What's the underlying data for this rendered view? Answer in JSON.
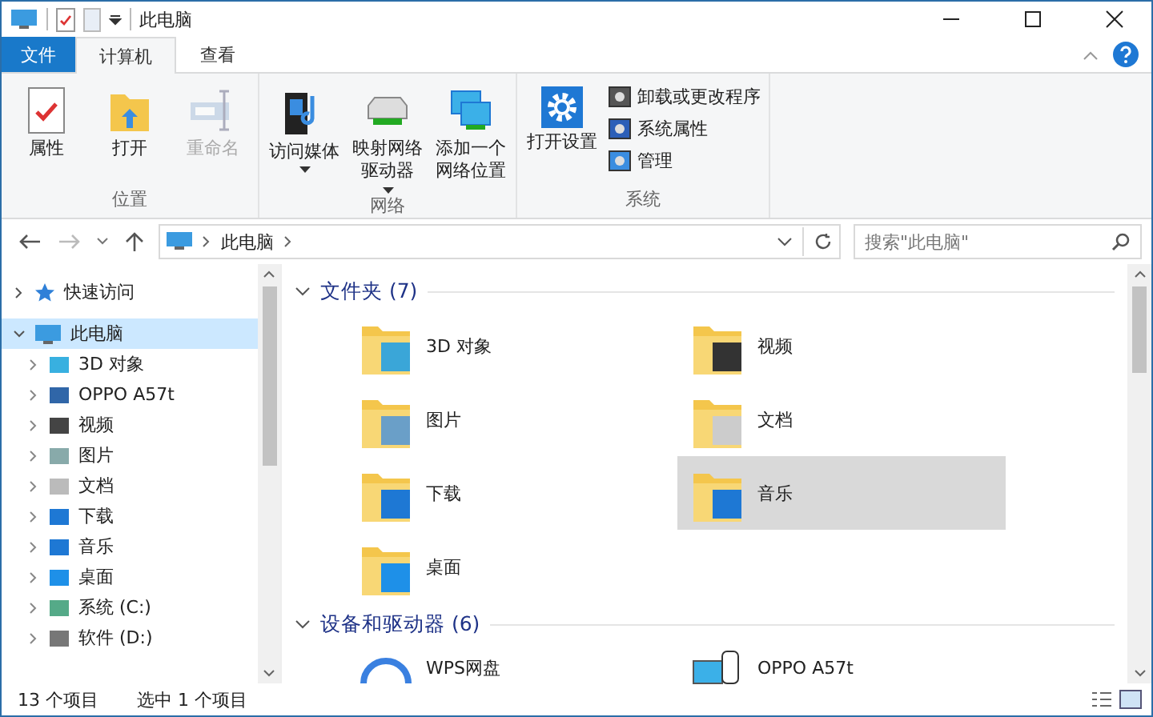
{
  "window": {
    "title": "此电脑"
  },
  "ribbon_tabs": [
    {
      "label": "文件",
      "kind": "file",
      "selected": false
    },
    {
      "label": "计算机",
      "kind": "tab",
      "selected": true
    },
    {
      "label": "查看",
      "kind": "tab",
      "selected": false
    }
  ],
  "ribbon_groups": [
    {
      "label": "位置",
      "commands": [
        {
          "label": "属性",
          "kind": "large",
          "disabled": false
        },
        {
          "label": "打开",
          "kind": "large",
          "disabled": false
        },
        {
          "label": "重命名",
          "kind": "large",
          "disabled": true
        }
      ]
    },
    {
      "label": "网络",
      "commands": [
        {
          "label": "访问媒体",
          "kind": "large",
          "disabled": false,
          "dropdown": true
        },
        {
          "label": "映射网络驱动器",
          "kind": "large",
          "disabled": false,
          "dropdown": true
        },
        {
          "label": "添加一个网络位置",
          "kind": "large",
          "disabled": false
        }
      ]
    },
    {
      "label": "系统",
      "commands": [
        {
          "label": "打开设置",
          "kind": "large",
          "disabled": false
        },
        {
          "label": "卸载或更改程序",
          "kind": "small",
          "disabled": false
        },
        {
          "label": "系统属性",
          "kind": "small",
          "disabled": false
        },
        {
          "label": "管理",
          "kind": "small",
          "disabled": false
        }
      ]
    }
  ],
  "address": {
    "breadcrumb": [
      "此电脑"
    ]
  },
  "search": {
    "placeholder": "搜索\"此电脑\""
  },
  "navigation": [
    {
      "label": "快速访问",
      "expanded": false,
      "selected": false
    },
    {
      "label": "此电脑",
      "expanded": true,
      "selected": true,
      "children": [
        {
          "label": "3D 对象",
          "expanded": false,
          "selected": false
        },
        {
          "label": "OPPO A57t",
          "expanded": false,
          "selected": false
        },
        {
          "label": "视频",
          "expanded": false,
          "selected": false
        },
        {
          "label": "图片",
          "expanded": false,
          "selected": false
        },
        {
          "label": "文档",
          "expanded": false,
          "selected": false
        },
        {
          "label": "下载",
          "expanded": false,
          "selected": false
        },
        {
          "label": "音乐",
          "expanded": false,
          "selected": false
        },
        {
          "label": "桌面",
          "expanded": false,
          "selected": false
        },
        {
          "label": "系统 (C:)",
          "expanded": false,
          "selected": false
        },
        {
          "label": "软件 (D:)",
          "expanded": false,
          "selected": false
        }
      ]
    }
  ],
  "sections": [
    {
      "title": "文件夹 (7)",
      "expanded": true,
      "items": [
        {
          "label": "3D 对象",
          "selected": false
        },
        {
          "label": "视频",
          "selected": false
        },
        {
          "label": "图片",
          "selected": false
        },
        {
          "label": "文档",
          "selected": false
        },
        {
          "label": "下载",
          "selected": false
        },
        {
          "label": "音乐",
          "selected": true
        },
        {
          "label": "桌面",
          "selected": false
        }
      ]
    },
    {
      "title": "设备和驱动器 (6)",
      "expanded": true,
      "items": [
        {
          "label": "WPS网盘",
          "selected": false
        },
        {
          "label": "OPPO A57t",
          "selected": false
        }
      ]
    }
  ],
  "status_bar": {
    "item_count": "13 个项目",
    "selection": "选中 1 个项目"
  }
}
